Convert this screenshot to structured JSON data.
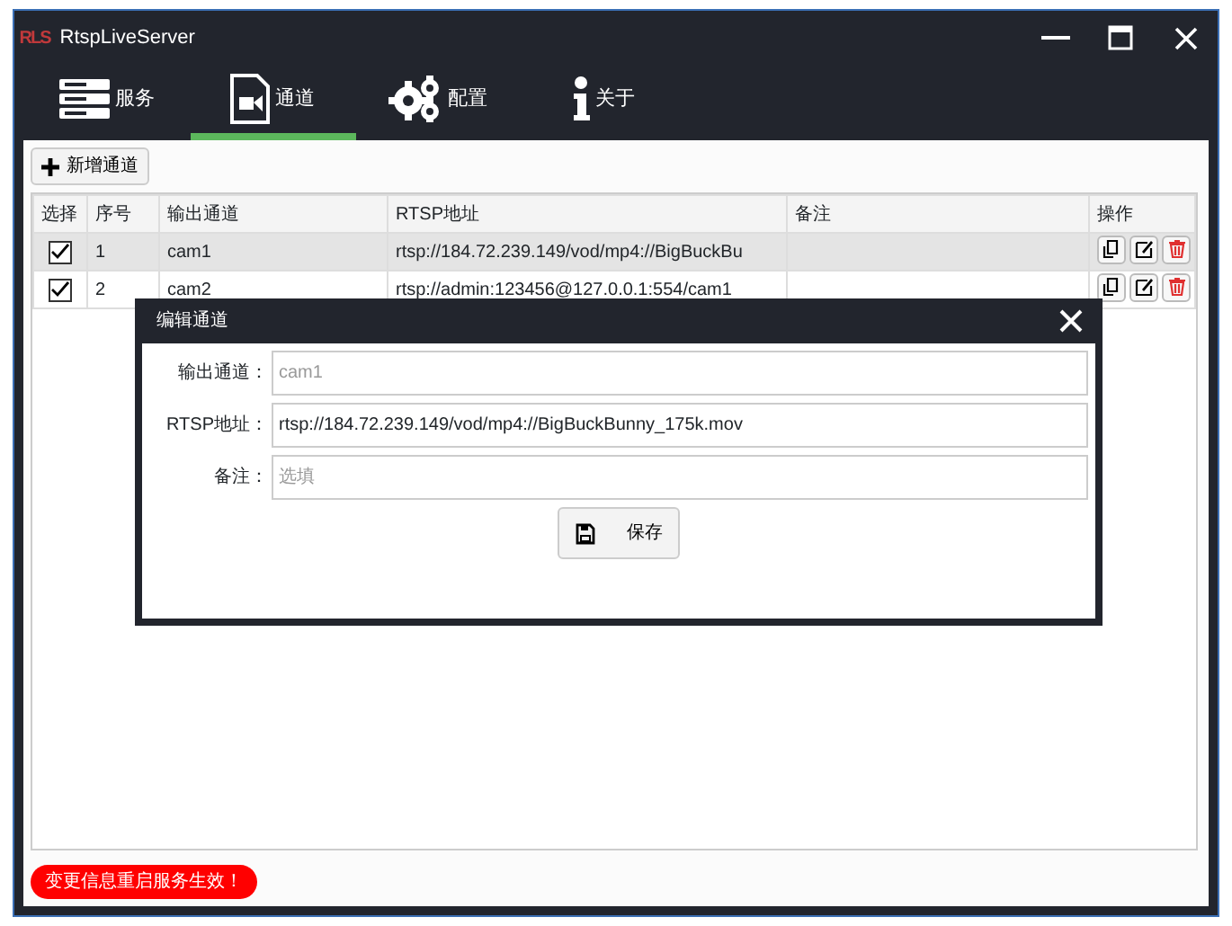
{
  "window": {
    "logo_text": "RLS",
    "title": "RtspLiveServer"
  },
  "tabs": [
    {
      "label": "服务",
      "selected": false
    },
    {
      "label": "通道",
      "selected": true
    },
    {
      "label": "配置",
      "selected": false
    },
    {
      "label": "关于",
      "selected": false
    }
  ],
  "toolbar": {
    "add_button": "新增通道"
  },
  "table": {
    "columns": [
      "选择",
      "序号",
      "输出通道",
      "RTSP地址",
      "备注",
      "操作"
    ],
    "rows": [
      {
        "checked": true,
        "selected": true,
        "index": "1",
        "channel": "cam1",
        "rtsp": "rtsp://184.72.239.149/vod/mp4://BigBuckBu"
      },
      {
        "checked": true,
        "selected": false,
        "index": "2",
        "channel": "cam2",
        "rtsp": "rtsp://admin:123456@127.0.0.1:554/cam1"
      }
    ]
  },
  "dialog": {
    "title": "编辑通道",
    "fields": [
      {
        "label": "输出通道：",
        "placeholder": "cam1"
      },
      {
        "label": "RTSP地址：",
        "value": "rtsp://184.72.239.149/vod/mp4://BigBuckBunny_175k.mov"
      },
      {
        "label": "备注：",
        "placeholder": "选填"
      }
    ],
    "save_button": "保存"
  },
  "status_bar": {
    "notice": "变更信息重启服务生效！"
  }
}
